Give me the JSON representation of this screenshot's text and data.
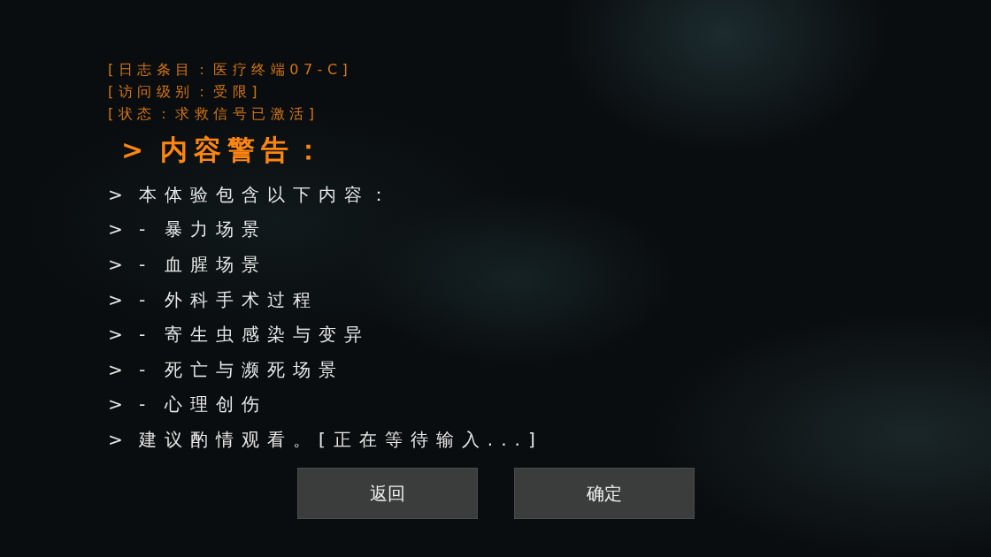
{
  "log_header": [
    "[日志条目：医疗终端07-C]",
    "[访问级别：受限]",
    "[状态：求救信号已激活]"
  ],
  "warning_title": {
    "prompt": ">",
    "text": "内容警告："
  },
  "lines": [
    {
      "kind": "text",
      "prompt": ">",
      "text": "本体验包含以下内容："
    },
    {
      "kind": "bullet",
      "prompt": ">",
      "bullet": "-",
      "text": "暴力场景"
    },
    {
      "kind": "bullet",
      "prompt": ">",
      "bullet": "-",
      "text": "血腥场景"
    },
    {
      "kind": "bullet",
      "prompt": ">",
      "bullet": "-",
      "text": "外科手术过程"
    },
    {
      "kind": "bullet",
      "prompt": ">",
      "bullet": "-",
      "text": "寄生虫感染与变异"
    },
    {
      "kind": "bullet",
      "prompt": ">",
      "bullet": "-",
      "text": "死亡与濒死场景"
    },
    {
      "kind": "bullet",
      "prompt": ">",
      "bullet": "-",
      "text": "心理创伤"
    },
    {
      "kind": "text",
      "prompt": ">",
      "text": "建议酌情观看。[正在等待输入...]"
    }
  ],
  "buttons": [
    {
      "label": "返回"
    },
    {
      "label": "确定"
    }
  ]
}
